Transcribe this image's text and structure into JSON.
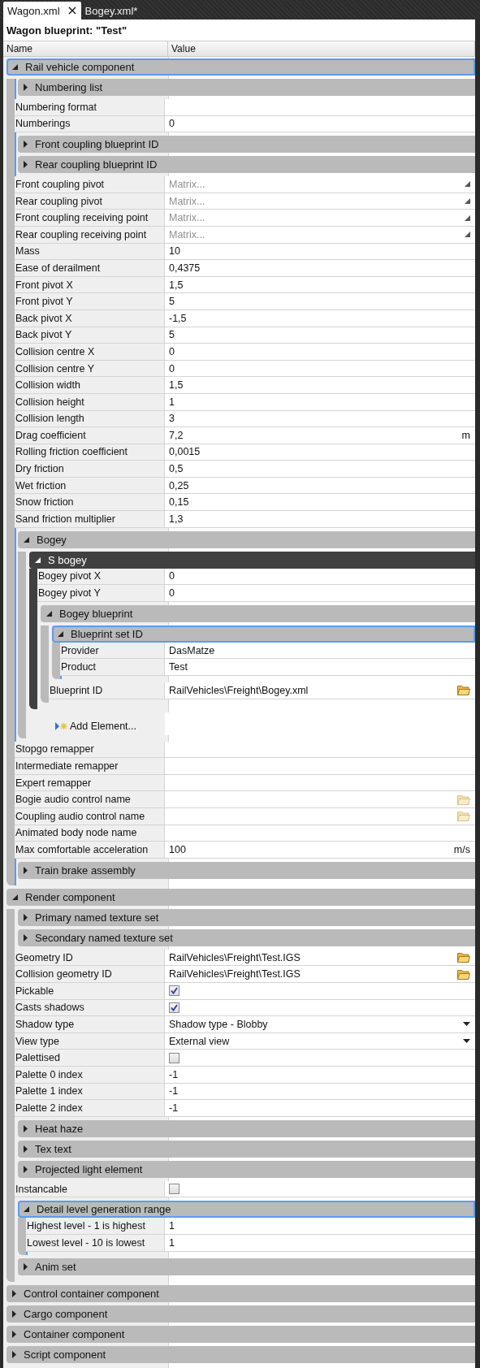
{
  "tabs": [
    {
      "label": "Wagon.xml",
      "selected": true
    },
    {
      "label": "Bogey.xml*",
      "selected": false
    }
  ],
  "title": "Wagon blueprint: \"Test\"",
  "columns": [
    "Name",
    "Value"
  ],
  "items": [
    {
      "kind": "group",
      "label": "Rail vehicle component",
      "expanded": true,
      "selected": true,
      "active": false,
      "children": [
        {
          "kind": "group",
          "label": "Numbering list",
          "expanded": false,
          "selected": false,
          "active": false
        },
        {
          "kind": "text",
          "label": "Numbering format"
        },
        {
          "kind": "text",
          "label": "Numberings",
          "value": "0"
        },
        {
          "kind": "group",
          "label": "Front coupling blueprint ID",
          "expanded": false,
          "selected": false,
          "active": false
        },
        {
          "kind": "group",
          "label": "Rear coupling blueprint ID",
          "expanded": false,
          "selected": false,
          "active": false
        },
        {
          "kind": "matrix",
          "label": "Front coupling pivot",
          "placeholder": "Matrix..."
        },
        {
          "kind": "matrix",
          "label": "Rear coupling pivot",
          "placeholder": "Matrix..."
        },
        {
          "kind": "matrix",
          "label": "Front coupling receiving point",
          "placeholder": "Matrix..."
        },
        {
          "kind": "matrix",
          "label": "Rear coupling receiving point",
          "placeholder": "Matrix..."
        },
        {
          "kind": "text",
          "label": "Mass",
          "value": "10"
        },
        {
          "kind": "text",
          "label": "Ease of derailment",
          "value": "0,4375"
        },
        {
          "kind": "text",
          "label": "Front pivot X",
          "value": "1,5"
        },
        {
          "kind": "text",
          "label": "Front pivot Y",
          "value": "5"
        },
        {
          "kind": "text",
          "label": "Back pivot X",
          "value": "-1,5"
        },
        {
          "kind": "text",
          "label": "Back pivot Y",
          "value": "5"
        },
        {
          "kind": "text",
          "label": "Collision centre X",
          "value": "0"
        },
        {
          "kind": "text",
          "label": "Collision centre Y",
          "value": "0"
        },
        {
          "kind": "text",
          "label": "Collision width",
          "value": "1,5"
        },
        {
          "kind": "text",
          "label": "Collision height",
          "value": "1"
        },
        {
          "kind": "text",
          "label": "Collision length",
          "value": "3"
        },
        {
          "kind": "text",
          "label": "Drag coefficient",
          "value": "7,2",
          "unit": "m"
        },
        {
          "kind": "text",
          "label": "Rolling friction coefficient",
          "value": "0,0015"
        },
        {
          "kind": "text",
          "label": "Dry friction",
          "value": "0,5"
        },
        {
          "kind": "text",
          "label": "Wet friction",
          "value": "0,25"
        },
        {
          "kind": "text",
          "label": "Snow friction",
          "value": "0,15"
        },
        {
          "kind": "text",
          "label": "Sand friction multiplier",
          "value": "1,3"
        },
        {
          "kind": "group",
          "label": "Bogey",
          "expanded": true,
          "selected": false,
          "active": false,
          "children": [
            {
              "kind": "group",
              "label": "S bogey",
              "expanded": true,
              "selected": false,
              "active": true,
              "children": [
                {
                  "kind": "text",
                  "label": "Bogey pivot X",
                  "value": "0"
                },
                {
                  "kind": "text",
                  "label": "Bogey pivot Y",
                  "value": "0"
                },
                {
                  "kind": "group",
                  "label": "Bogey blueprint",
                  "expanded": true,
                  "selected": false,
                  "active": false,
                  "children": [
                    {
                      "kind": "group",
                      "label": "Blueprint set ID",
                      "expanded": true,
                      "selected": true,
                      "active": false,
                      "children": [
                        {
                          "kind": "text",
                          "label": "Provider",
                          "value": "DasMatze"
                        },
                        {
                          "kind": "text",
                          "label": "Product",
                          "value": "Test"
                        }
                      ]
                    },
                    {
                      "kind": "file",
                      "label": "Blueprint ID",
                      "value": "RailVehicles\\Freight\\Bogey.xml"
                    }
                  ]
                }
              ]
            },
            {
              "kind": "add",
              "label": "Add Element..."
            }
          ]
        },
        {
          "kind": "text",
          "label": "Stopgo remapper"
        },
        {
          "kind": "text",
          "label": "Intermediate remapper"
        },
        {
          "kind": "text",
          "label": "Expert remapper"
        },
        {
          "kind": "file",
          "label": "Bogie audio control name"
        },
        {
          "kind": "file",
          "label": "Coupling audio control name"
        },
        {
          "kind": "text",
          "label": "Animated body node name"
        },
        {
          "kind": "text",
          "label": "Max comfortable acceleration",
          "value": "100",
          "unit": "m/s"
        },
        {
          "kind": "group",
          "label": "Train brake assembly",
          "expanded": false,
          "selected": false,
          "active": false
        }
      ]
    },
    {
      "kind": "group",
      "label": "Render component",
      "expanded": true,
      "selected": false,
      "active": false,
      "children": [
        {
          "kind": "group",
          "label": "Primary named texture set",
          "expanded": false,
          "selected": false,
          "active": false
        },
        {
          "kind": "group",
          "label": "Secondary named texture set",
          "expanded": false,
          "selected": false,
          "active": false
        },
        {
          "kind": "file",
          "label": "Geometry ID",
          "value": "RailVehicles\\Freight\\Test.IGS"
        },
        {
          "kind": "file",
          "label": "Collision geometry ID",
          "value": "RailVehicles\\Freight\\Test.IGS"
        },
        {
          "kind": "checkbox",
          "label": "Pickable",
          "checked": true
        },
        {
          "kind": "checkbox",
          "label": "Casts shadows",
          "checked": true
        },
        {
          "kind": "dropdown",
          "label": "Shadow type",
          "value": "Shadow type - Blobby"
        },
        {
          "kind": "dropdown",
          "label": "View type",
          "value": "External view"
        },
        {
          "kind": "checkbox",
          "label": "Palettised",
          "checked": false
        },
        {
          "kind": "text",
          "label": "Palette 0 index",
          "value": "-1"
        },
        {
          "kind": "text",
          "label": "Palette 1 index",
          "value": "-1"
        },
        {
          "kind": "text",
          "label": "Palette 2 index",
          "value": "-1"
        },
        {
          "kind": "group",
          "label": "Heat haze",
          "expanded": false,
          "selected": false,
          "active": false
        },
        {
          "kind": "group",
          "label": "Tex text",
          "expanded": false,
          "selected": false,
          "active": false
        },
        {
          "kind": "group",
          "label": "Projected light element",
          "expanded": false,
          "selected": false,
          "active": false
        },
        {
          "kind": "checkbox",
          "label": "Instancable",
          "checked": false
        },
        {
          "kind": "group",
          "label": "Detail level generation range",
          "expanded": true,
          "selected": true,
          "active": false,
          "children": [
            {
              "kind": "text",
              "label": "Highest level - 1 is highest",
              "value": "1"
            },
            {
              "kind": "text",
              "label": "Lowest level - 10 is lowest",
              "value": "1"
            }
          ]
        },
        {
          "kind": "group",
          "label": "Anim set",
          "expanded": false,
          "selected": false,
          "active": false
        }
      ]
    },
    {
      "kind": "group",
      "label": "Control container component",
      "expanded": false,
      "selected": false,
      "active": false
    },
    {
      "kind": "group",
      "label": "Cargo component",
      "expanded": false,
      "selected": false,
      "active": false
    },
    {
      "kind": "group",
      "label": "Container component",
      "expanded": false,
      "selected": false,
      "active": false
    },
    {
      "kind": "group",
      "label": "Script component",
      "expanded": false,
      "selected": false,
      "active": false
    }
  ]
}
